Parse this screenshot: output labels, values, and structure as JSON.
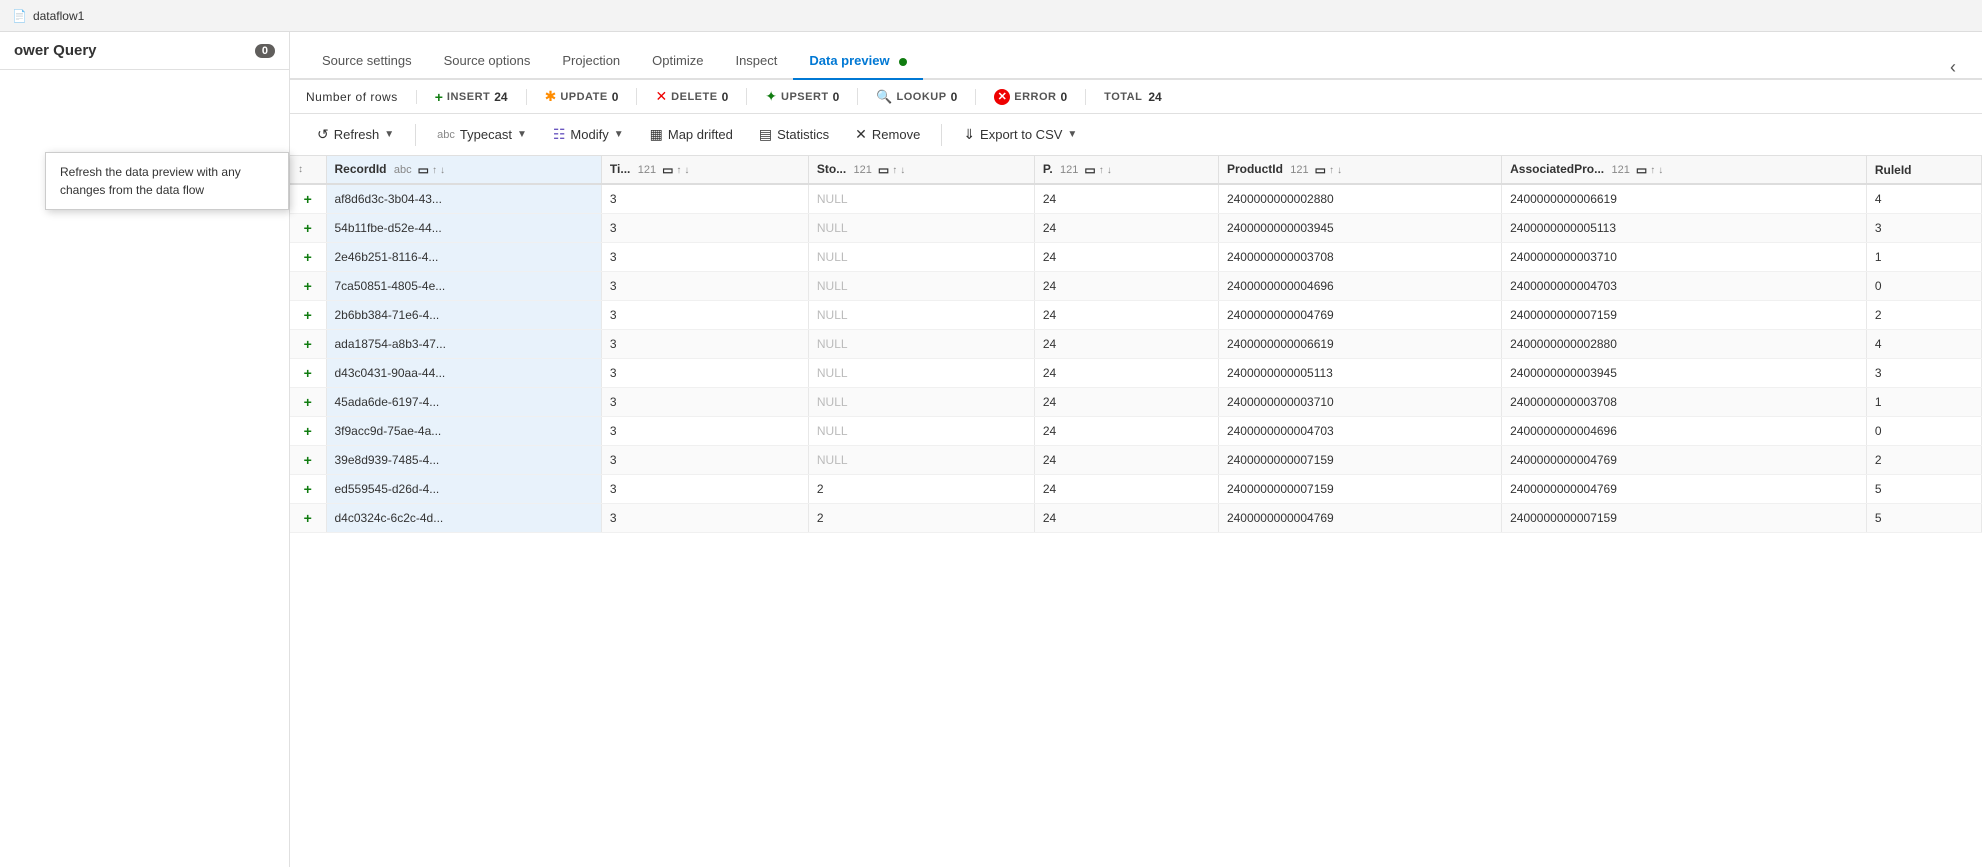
{
  "breadcrumb": {
    "text": "dataflow1"
  },
  "sidebar": {
    "title": "ower Query",
    "badge": "0"
  },
  "tooltip": {
    "text": "Refresh the data preview with any changes from the data flow"
  },
  "tabs": [
    {
      "id": "source-settings",
      "label": "Source settings",
      "active": false
    },
    {
      "id": "source-options",
      "label": "Source options",
      "active": false
    },
    {
      "id": "projection",
      "label": "Projection",
      "active": false
    },
    {
      "id": "optimize",
      "label": "Optimize",
      "active": false
    },
    {
      "id": "inspect",
      "label": "Inspect",
      "active": false
    },
    {
      "id": "data-preview",
      "label": "Data preview",
      "active": true,
      "dot": true
    }
  ],
  "stats": {
    "number_of_rows_label": "Number of rows",
    "insert_label": "INSERT",
    "insert_value": "24",
    "update_label": "UPDATE",
    "update_value": "0",
    "delete_label": "DELETE",
    "delete_value": "0",
    "upsert_label": "UPSERT",
    "upsert_value": "0",
    "lookup_label": "LOOKUP",
    "lookup_value": "0",
    "error_label": "ERROR",
    "error_value": "0",
    "total_label": "TOTAL",
    "total_value": "24"
  },
  "toolbar": {
    "refresh_label": "Refresh",
    "typecast_label": "Typecast",
    "modify_label": "Modify",
    "map_drifted_label": "Map drifted",
    "statistics_label": "Statistics",
    "remove_label": "Remove",
    "export_csv_label": "Export to CSV"
  },
  "columns": [
    {
      "name": "RecordId",
      "type": "abc",
      "highlight": true
    },
    {
      "name": "Ti...",
      "type": "121"
    },
    {
      "name": "Sto...",
      "type": "121"
    },
    {
      "name": "P.",
      "type": "121"
    },
    {
      "name": "ProductId",
      "type": "121"
    },
    {
      "name": "AssociatedPro...",
      "type": "121"
    },
    {
      "name": "RuleId",
      "type": ""
    }
  ],
  "rows": [
    {
      "id": "af8d6d3c-3b04-43...",
      "ti": "3",
      "sto": "NULL",
      "p": "24",
      "productId": "2400000000002880",
      "assoc": "2400000000006619",
      "ruleId": "4"
    },
    {
      "id": "54b11fbe-d52e-44...",
      "ti": "3",
      "sto": "NULL",
      "p": "24",
      "productId": "2400000000003945",
      "assoc": "2400000000005113",
      "ruleId": "3"
    },
    {
      "id": "2e46b251-8116-4...",
      "ti": "3",
      "sto": "NULL",
      "p": "24",
      "productId": "2400000000003708",
      "assoc": "2400000000003710",
      "ruleId": "1"
    },
    {
      "id": "7ca50851-4805-4e...",
      "ti": "3",
      "sto": "NULL",
      "p": "24",
      "productId": "2400000000004696",
      "assoc": "2400000000004703",
      "ruleId": "0"
    },
    {
      "id": "2b6bb384-71e6-4...",
      "ti": "3",
      "sto": "NULL",
      "p": "24",
      "productId": "2400000000004769",
      "assoc": "2400000000007159",
      "ruleId": "2"
    },
    {
      "id": "ada18754-a8b3-47...",
      "ti": "3",
      "sto": "NULL",
      "p": "24",
      "productId": "2400000000006619",
      "assoc": "2400000000002880",
      "ruleId": "4"
    },
    {
      "id": "d43c0431-90aa-44...",
      "ti": "3",
      "sto": "NULL",
      "p": "24",
      "productId": "2400000000005113",
      "assoc": "2400000000003945",
      "ruleId": "3"
    },
    {
      "id": "45ada6de-6197-4...",
      "ti": "3",
      "sto": "NULL",
      "p": "24",
      "productId": "2400000000003710",
      "assoc": "2400000000003708",
      "ruleId": "1"
    },
    {
      "id": "3f9acc9d-75ae-4a...",
      "ti": "3",
      "sto": "NULL",
      "p": "24",
      "productId": "2400000000004703",
      "assoc": "2400000000004696",
      "ruleId": "0"
    },
    {
      "id": "39e8d939-7485-4...",
      "ti": "3",
      "sto": "NULL",
      "p": "24",
      "productId": "2400000000007159",
      "assoc": "2400000000004769",
      "ruleId": "2"
    },
    {
      "id": "ed559545-d26d-4...",
      "ti": "3",
      "sto": "2",
      "p": "24",
      "productId": "2400000000007159",
      "assoc": "2400000000004769",
      "ruleId": "5"
    },
    {
      "id": "d4c0324c-6c2c-4d...",
      "ti": "3",
      "sto": "2",
      "p": "24",
      "productId": "2400000000004769",
      "assoc": "2400000000007159",
      "ruleId": "5"
    }
  ]
}
